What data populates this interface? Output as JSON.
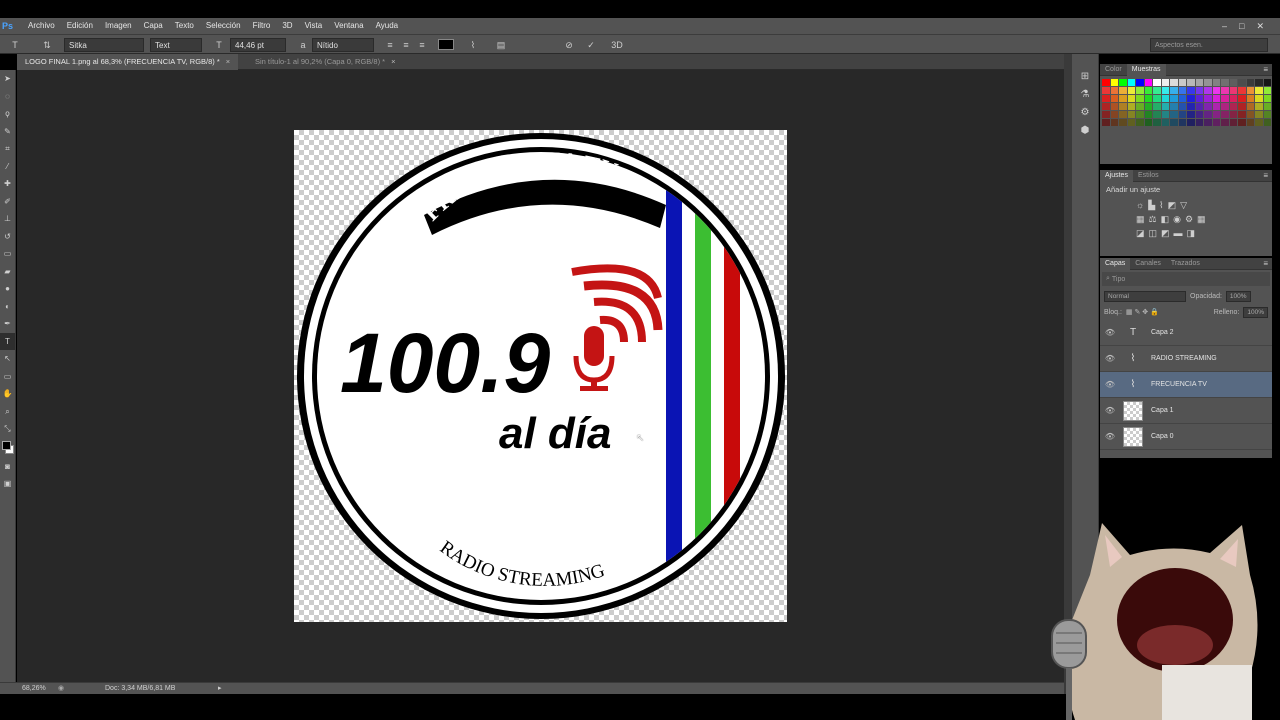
{
  "app": {
    "logo": "Ps"
  },
  "menu": [
    "Archivo",
    "Edición",
    "Imagen",
    "Capa",
    "Texto",
    "Selección",
    "Filtro",
    "3D",
    "Vista",
    "Ventana",
    "Ayuda"
  ],
  "window_controls": {
    "minimize": "–",
    "restore": "□",
    "close": "✕"
  },
  "options": {
    "font_family": "Sitka",
    "font_style": "Text",
    "font_size": "44,46 pt",
    "antialias": "Nítido",
    "text_color": "#000000",
    "workspace": "Aspectos esen."
  },
  "tabs": [
    {
      "label": "LOGO FINAL 1.png al 68,3% (FRECUENCIA TV, RGB/8) *",
      "close": "×",
      "active": true
    },
    {
      "label": "Sin título-1 al 90,2% (Capa 0, RGB/8) *",
      "close": "×",
      "active": false
    }
  ],
  "logo": {
    "arc_top": "FRECUENCIA TV",
    "frequency": "100.9",
    "tagline": "al día",
    "arc_bottom": "RADIO STREAMING",
    "colors": {
      "blue": "#0a14b4",
      "green": "#3cbe32",
      "red": "#c80a0a",
      "mic": "#c41414"
    }
  },
  "status": {
    "zoom": "68,26%",
    "doc": "Doc: 3,34 MB/6,81 MB"
  },
  "panels": {
    "color_tabs": [
      "Color",
      "Muestras"
    ],
    "adjust_tabs": [
      "Ajustes",
      "Estilos"
    ],
    "adjust_title": "Añadir un ajuste",
    "layers_tabs": [
      "Capas",
      "Canales",
      "Trazados"
    ],
    "filter_label": "Tipo",
    "blend_mode": "Normal",
    "opacity_label": "Opacidad:",
    "opacity_value": "100%",
    "lock_label": "Bloq.:",
    "fill_label": "Relleno:",
    "fill_value": "100%"
  },
  "layers": [
    {
      "name": "Capa 2",
      "kind": "text-icon",
      "selected": false
    },
    {
      "name": "RADIO STREAMING",
      "kind": "text-warp-icon",
      "selected": false
    },
    {
      "name": "FRECUENCIA TV",
      "kind": "text-warp-icon",
      "selected": true
    },
    {
      "name": "Capa 1",
      "kind": "image",
      "selected": false
    },
    {
      "name": "Capa 0",
      "kind": "image",
      "selected": false
    }
  ]
}
